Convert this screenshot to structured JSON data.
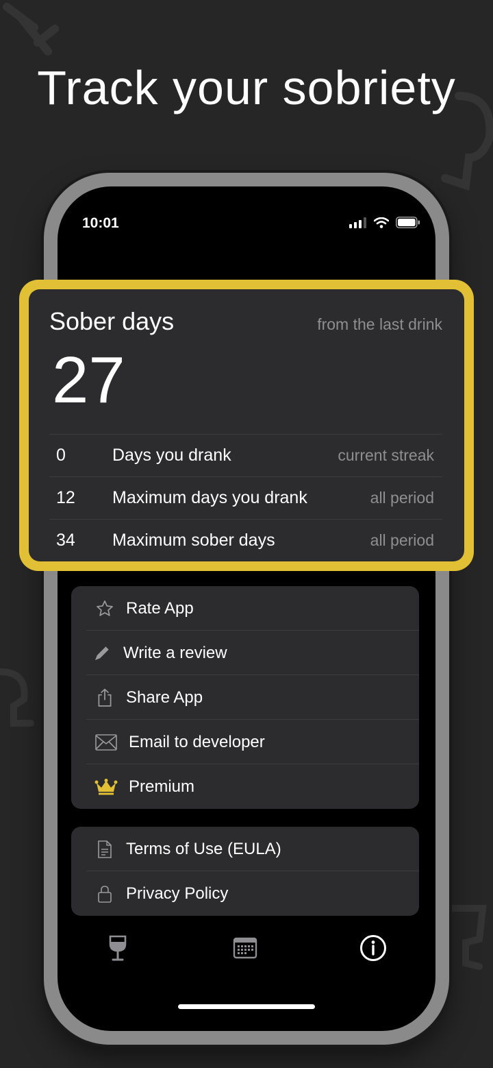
{
  "headline": "Track your sobriety",
  "status_bar": {
    "time": "10:01"
  },
  "sober_card": {
    "title": "Sober days",
    "subtitle": "from the last drink",
    "value": "27",
    "stats": [
      {
        "value": "0",
        "label": "Days you drank",
        "note": "current streak"
      },
      {
        "value": "12",
        "label": "Maximum days you drank",
        "note": "all period"
      },
      {
        "value": "34",
        "label": "Maximum sober days",
        "note": "all period"
      }
    ]
  },
  "menu": {
    "items": [
      {
        "label": "Rate App",
        "icon": "star-icon"
      },
      {
        "label": "Write a review",
        "icon": "pencil-icon"
      },
      {
        "label": "Share App",
        "icon": "share-icon"
      },
      {
        "label": "Email to developer",
        "icon": "envelope-icon"
      },
      {
        "label": "Premium",
        "icon": "crown-icon"
      }
    ]
  },
  "legal": {
    "items": [
      {
        "label": "Terms of Use (EULA)",
        "icon": "document-icon"
      },
      {
        "label": "Privacy Policy",
        "icon": "lock-icon"
      }
    ]
  },
  "tabbar": {
    "tabs": [
      {
        "icon": "wine-glass-icon",
        "active": false
      },
      {
        "icon": "calendar-icon",
        "active": false
      },
      {
        "icon": "info-icon",
        "active": true
      }
    ]
  },
  "colors": {
    "accent": "#e2c035",
    "background": "#262626",
    "card": "#2c2c2e",
    "muted": "#8e8e93"
  }
}
